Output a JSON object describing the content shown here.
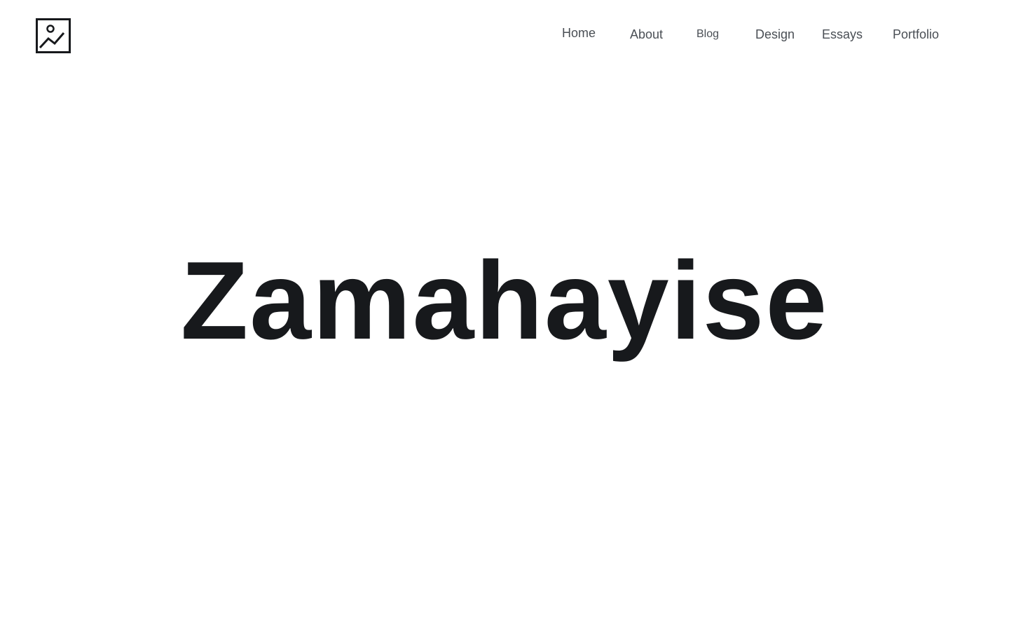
{
  "header": {
    "logo_icon": "image-placeholder-icon",
    "nav": {
      "home": "Home",
      "about": "About",
      "blog": "Blog",
      "design": "Design",
      "essays": "Essays",
      "portfolio": "Portfolio"
    }
  },
  "hero": {
    "title": "Zamahayise"
  },
  "colors": {
    "text": "#17191c",
    "nav_text": "#4a4f55",
    "background": "#ffffff"
  }
}
